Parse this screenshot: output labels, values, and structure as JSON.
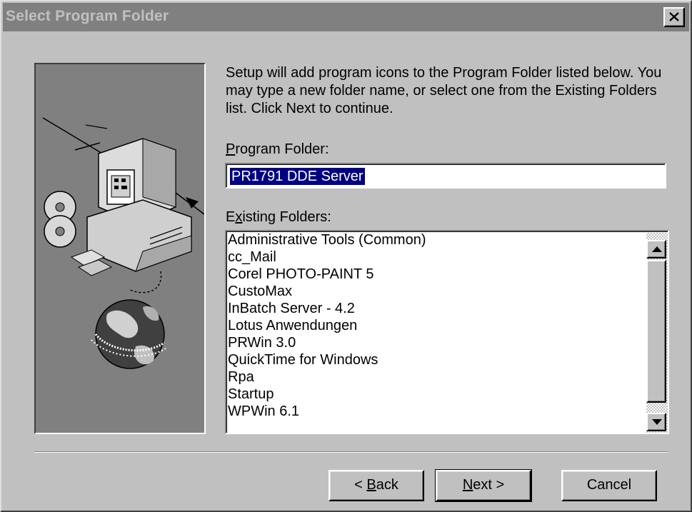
{
  "window": {
    "title": "Select Program Folder"
  },
  "description": "Setup will add program icons to the Program Folder listed below. You may type a new folder name, or select one from the Existing Folders list.  Click Next to continue.",
  "program_folder": {
    "label_accel": "P",
    "label_rest": "rogram Folder:",
    "value": "PR1791 DDE Server"
  },
  "existing_folders": {
    "label_pre": "E",
    "label_accel": "x",
    "label_rest": "isting Folders:",
    "items": [
      "Administrative Tools (Common)",
      "cc_Mail",
      "Corel PHOTO-PAINT 5",
      "CustoMax",
      "InBatch Server - 4.2",
      "Lotus Anwendungen",
      "PRWin 3.0",
      "QuickTime for Windows",
      "Rpa",
      "Startup",
      "WPWin 6.1"
    ]
  },
  "buttons": {
    "back_pre": "< ",
    "back_accel": "B",
    "back_rest": "ack",
    "next_accel": "N",
    "next_rest": "ext >",
    "cancel": "Cancel"
  },
  "icons": {
    "close": "close-icon",
    "scroll_up": "scroll-up-arrow-icon",
    "scroll_down": "scroll-down-arrow-icon",
    "illustration": "computer-setup-illustration"
  }
}
